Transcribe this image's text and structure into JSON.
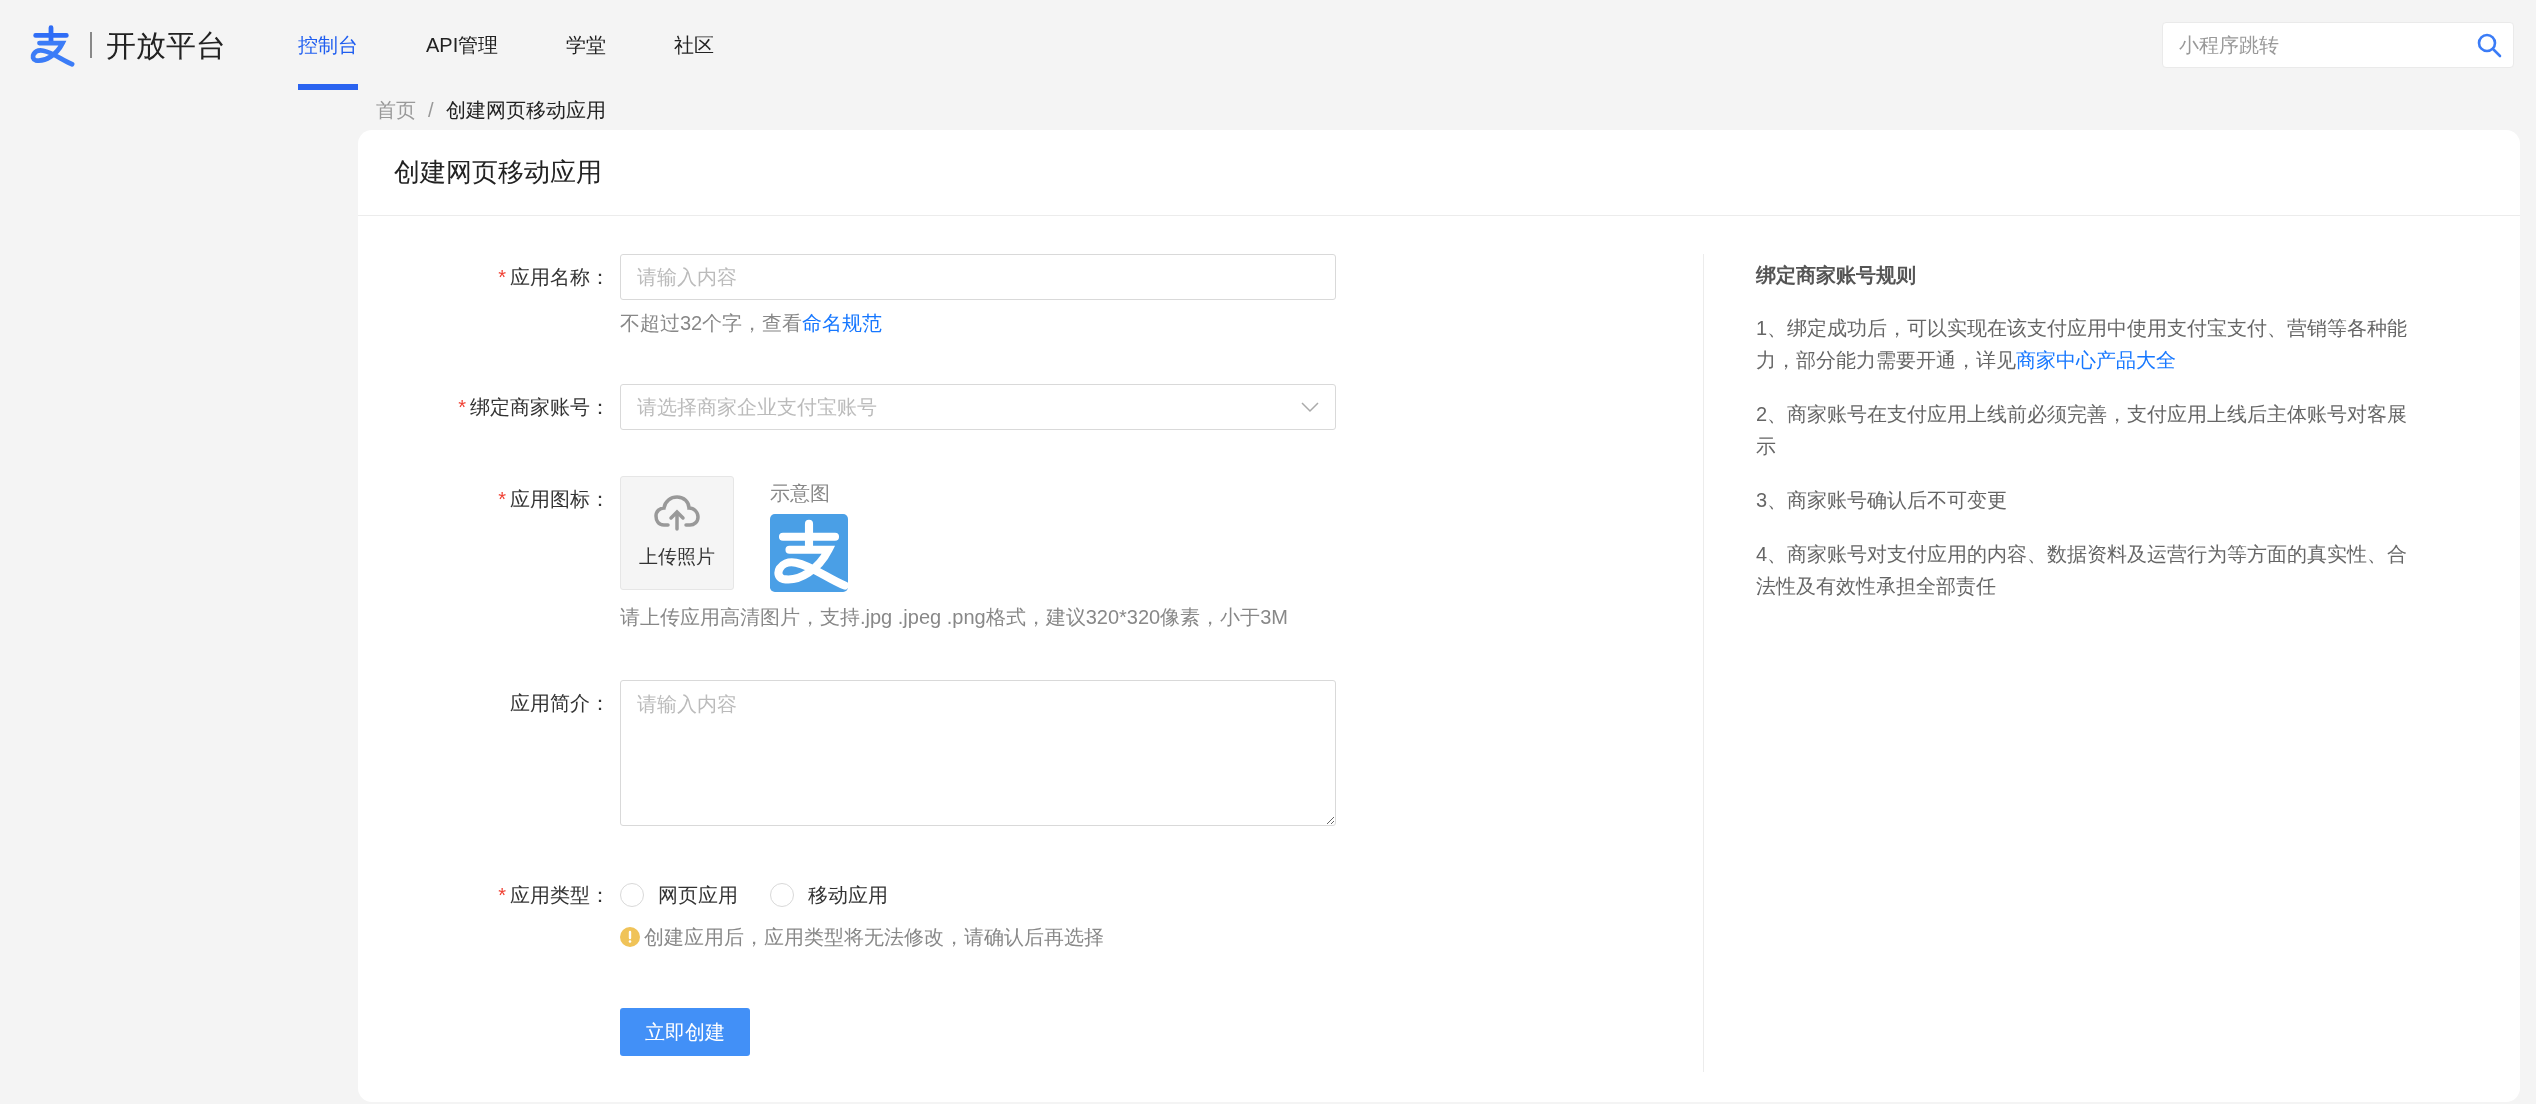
{
  "header": {
    "brand": "开放平台",
    "nav": [
      {
        "label": "控制台",
        "selected": true
      },
      {
        "label": "API管理",
        "selected": false
      },
      {
        "label": "学堂",
        "selected": false
      },
      {
        "label": "社区",
        "selected": false
      }
    ],
    "search": {
      "placeholder": "小程序跳转"
    }
  },
  "breadcrumb": {
    "separator": "/",
    "items": [
      "首页",
      "创建网页移动应用"
    ]
  },
  "card": {
    "title": "创建网页移动应用"
  },
  "form": {
    "fields": [
      {
        "kind": "text",
        "required_mark": "*",
        "label": "应用名称：",
        "placeholder": "请输入内容",
        "hint": "不超过32个字，查看",
        "hint_link": "命名规范"
      },
      {
        "kind": "select",
        "required_mark": "*",
        "label": "绑定商家账号：",
        "placeholder": "请选择商家企业支付宝账号"
      },
      {
        "kind": "upload",
        "required_mark": "*",
        "label": "应用图标：",
        "upload_label": "上传照片",
        "sample_label": "示意图",
        "hint": "请上传应用高清图片，支持.jpg .jpeg .png格式，建议320*320像素，小于3M"
      },
      {
        "kind": "textarea",
        "label": "应用简介：",
        "placeholder": "请输入内容"
      },
      {
        "kind": "radio",
        "required_mark": "*",
        "label": "应用类型：",
        "options": [
          {
            "label": "网页应用",
            "selected": false
          },
          {
            "label": "移动应用",
            "selected": false
          }
        ],
        "warning": "创建应用后，应用类型将无法修改，请确认后再选择"
      }
    ],
    "submit": "立即创建"
  },
  "rules": {
    "title": "绑定商家账号规则",
    "items": [
      {
        "text": "1、绑定成功后，可以实现在该支付应用中使用支付宝支付、营销等各种能力，部分能力需要开通，详见",
        "link": "商家中心产品大全"
      },
      {
        "text": "2、商家账号在支付应用上线前必须完善，支付应用上线后主体账号对客展示"
      },
      {
        "text": "3、商家账号确认后不可变更"
      },
      {
        "text": "4、商家账号对支付应用的内容、数据资料及运营行为等方面的真实性、合法性及有效性承担全部责任"
      }
    ]
  }
}
